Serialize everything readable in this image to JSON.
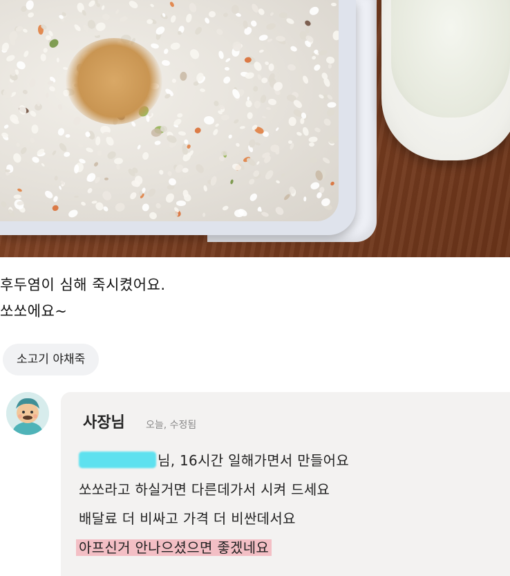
{
  "photo": {
    "alt_description": ""
  },
  "review": {
    "lines": [
      "후두염이 심해 죽시켰어요.",
      "쏘쏘에요~"
    ],
    "menu_tag": "소고기 야채죽"
  },
  "reply": {
    "author": "사장님",
    "meta": "오늘, 수정됨",
    "lines": [
      "님, 16시간 일해가면서 만들어요",
      "쏘쏘라고 하실거면 다른데가서 시켜 드세요",
      "배달료 더 비싸고 가격 더 비싼데서요",
      "아프신거 안나으셨으면 좋겠네요"
    ]
  },
  "colors": {
    "highlight": "#f396a0",
    "redaction": "#5ee1ef",
    "reply_bg": "#f3f2f1",
    "chip_bg": "#f1f2f4"
  }
}
